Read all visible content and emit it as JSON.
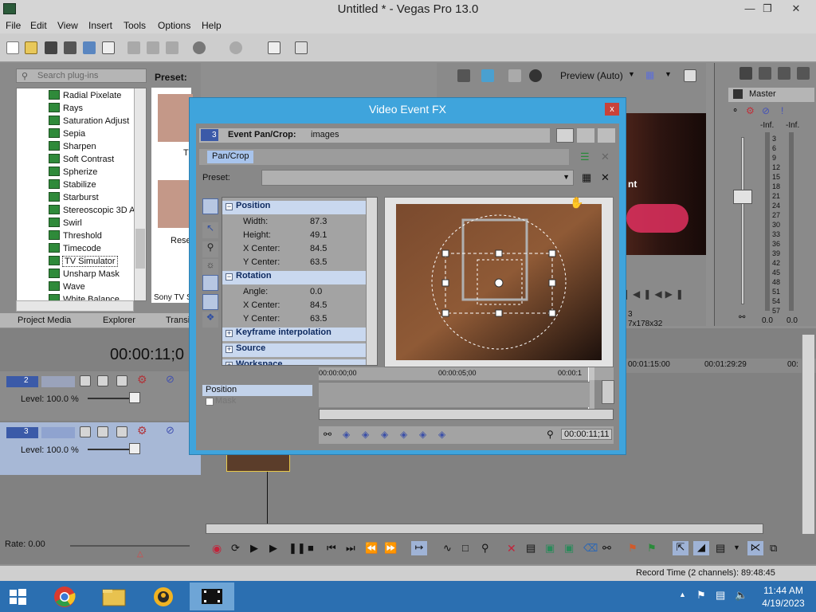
{
  "window": {
    "title": "Untitled * - Vegas Pro 13.0"
  },
  "menu": [
    "File",
    "Edit",
    "View",
    "Insert",
    "Tools",
    "Options",
    "Help"
  ],
  "plugins": {
    "search_placeholder": "Search plug-ins",
    "preset_label": "Preset:",
    "items": [
      "Radial Pixelate",
      "Rays",
      "Saturation Adjust",
      "Sepia",
      "Sharpen",
      "Soft Contrast",
      "Spherize",
      "Stabilize",
      "Starburst",
      "Stereoscopic 3D A",
      "Swirl",
      "Threshold",
      "Timecode",
      "TV Simulator",
      "Unsharp Mask",
      "Wave",
      "White Balance"
    ],
    "selected": "TV Simulator",
    "thumb_labels": [
      "T",
      "Rese"
    ],
    "footer_text": "Sony TV S"
  },
  "tabs": [
    "Project Media",
    "Explorer",
    "Transi"
  ],
  "preview": {
    "quality": "Preview (Auto)",
    "overlay_text": "nt",
    "info_a": "3",
    "info_b": "7x178x32"
  },
  "master": {
    "title": "Master",
    "inf_left": "-Inf.",
    "inf_right": "-Inf.",
    "scale": [
      "3",
      "6",
      "9",
      "12",
      "15",
      "18",
      "21",
      "24",
      "27",
      "30",
      "33",
      "36",
      "39",
      "42",
      "45",
      "48",
      "51",
      "54",
      "57"
    ],
    "bottom_left": "0.0",
    "bottom_right": "0.0"
  },
  "timeline": {
    "time_display": "00:00:11;0",
    "ruler": [
      "00:01:15:00",
      "00:01:29:29",
      "00:"
    ],
    "tracks": [
      {
        "number": "2",
        "level": "Level: 100.0 %"
      },
      {
        "number": "3",
        "level": "Level: 100.0 %"
      }
    ],
    "rate": "Rate: 0.00",
    "record_time": "Record Time (2 channels): 89:48:45"
  },
  "dialog": {
    "title": "Video Event FX",
    "close": "x",
    "track_num": "3",
    "header_label": "Event Pan/Crop:",
    "header_value": "images",
    "chain_item": "Pan/Crop",
    "preset_label": "Preset:",
    "sections": [
      {
        "name": "Position",
        "props": [
          [
            "Width:",
            "87.3"
          ],
          [
            "Height:",
            "49.1"
          ],
          [
            "X Center:",
            "84.5"
          ],
          [
            "Y Center:",
            "63.5"
          ]
        ]
      },
      {
        "name": "Rotation",
        "props": [
          [
            "Angle:",
            "0.0"
          ],
          [
            "X Center:",
            "84.5"
          ],
          [
            "Y Center:",
            "63.5"
          ]
        ]
      }
    ],
    "collapsed": [
      "Keyframe interpolation",
      "Source",
      "Workspace"
    ],
    "kf_ruler": [
      "00:00:00;00",
      "00:00:05;00",
      "00:00:1"
    ],
    "kf_rows": [
      "Position",
      "Mask"
    ],
    "time": "00:00:11;11"
  },
  "taskbar": {
    "time": "11:44 AM",
    "date": "4/19/2023"
  }
}
